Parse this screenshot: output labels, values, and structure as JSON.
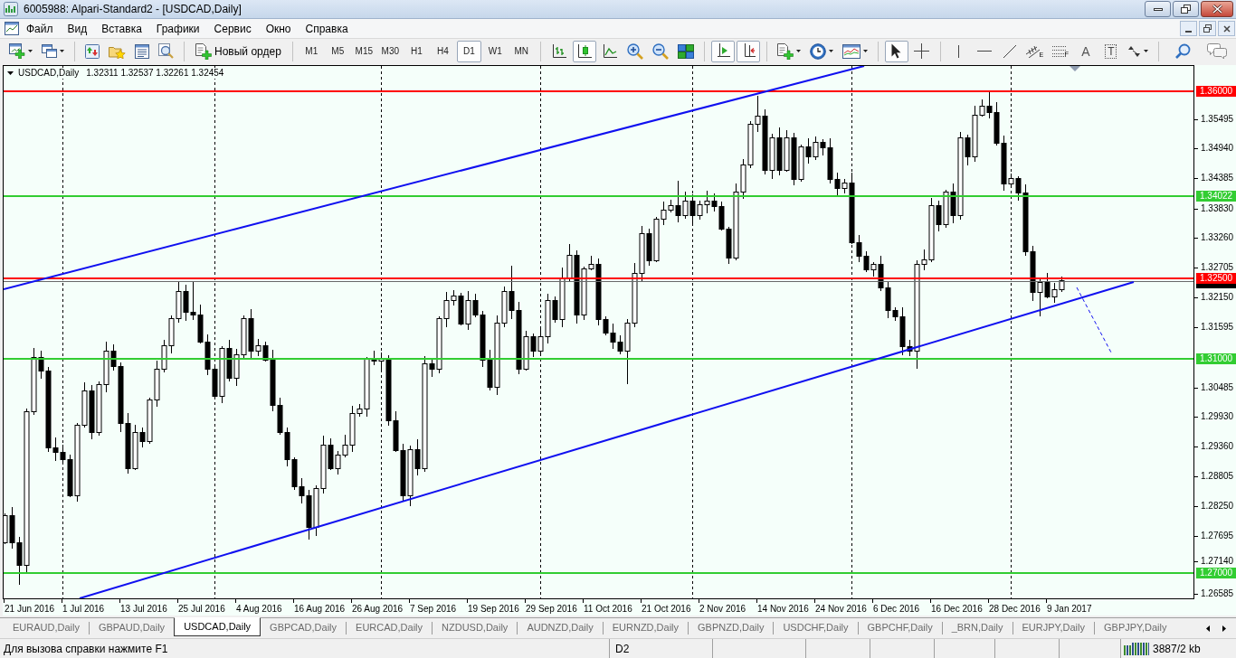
{
  "window": {
    "title": "6005988: Alpari-Standard2 - [USDCAD,Daily]"
  },
  "menu": [
    "Файл",
    "Вид",
    "Вставка",
    "Графики",
    "Сервис",
    "Окно",
    "Справка"
  ],
  "toolbar": {
    "new_order": "Новый ордер",
    "timeframes": [
      {
        "label": "M1",
        "selected": false
      },
      {
        "label": "M5",
        "selected": false
      },
      {
        "label": "M15",
        "selected": false
      },
      {
        "label": "M30",
        "selected": false
      },
      {
        "label": "H1",
        "selected": false
      },
      {
        "label": "H4",
        "selected": false
      },
      {
        "label": "D1",
        "selected": true
      },
      {
        "label": "W1",
        "selected": false
      },
      {
        "label": "MN",
        "selected": false
      }
    ],
    "chart_types": [
      {
        "kind": "bars",
        "selected": false
      },
      {
        "kind": "candles",
        "selected": true
      },
      {
        "kind": "line",
        "selected": false
      }
    ],
    "chart_options": [
      {
        "kind": "autoscroll",
        "on": true
      },
      {
        "kind": "shift",
        "on": true
      }
    ],
    "drawing_tools": [
      {
        "kind": "cursor",
        "selected": true
      },
      {
        "kind": "crosshair",
        "selected": false
      },
      {
        "kind": "vline",
        "selected": false
      },
      {
        "kind": "hline",
        "selected": false
      },
      {
        "kind": "trendline",
        "selected": false
      },
      {
        "kind": "channel",
        "label": "E",
        "selected": false
      },
      {
        "kind": "fibo",
        "label": "F",
        "selected": false
      },
      {
        "kind": "text",
        "label": "A",
        "selected": false
      },
      {
        "kind": "text-label",
        "label": "T",
        "selected": false
      }
    ]
  },
  "chart": {
    "symbol": "USDCAD,Daily",
    "ohlc": "1.32311 1.32537 1.32261 1.32454",
    "levels": [
      {
        "label": "1.36000",
        "color": "#ff0000"
      },
      {
        "label": "1.34022",
        "color": "#32cd32"
      },
      {
        "label": "1.32500",
        "color": "#ff0000"
      },
      {
        "label": "1.31000",
        "color": "#32cd32"
      },
      {
        "label": "1.27000",
        "color": "#32cd32"
      }
    ],
    "price_labels": [
      "1.35495",
      "1.34940",
      "1.34385",
      "1.33830",
      "1.33260",
      "1.32705",
      "1.32150",
      "1.31595",
      "1.30485",
      "1.29930",
      "1.29360",
      "1.28805",
      "1.28250",
      "1.27695",
      "1.27140",
      "1.26585"
    ],
    "date_labels": [
      "21 Jun 2016",
      "1 Jul 2016",
      "13 Jul 2016",
      "25 Jul 2016",
      "4 Aug 2016",
      "16 Aug 2016",
      "26 Aug 2016",
      "7 Sep 2016",
      "19 Sep 2016",
      "29 Sep 2016",
      "11 Oct 2016",
      "21 Oct 2016",
      "2 Nov 2016",
      "14 Nov 2016",
      "24 Nov 2016",
      "6 Dec 2016",
      "16 Dec 2016",
      "28 Dec 2016",
      "9 Jan 2017"
    ]
  },
  "tabs": [
    {
      "label": "EURAUD,Daily",
      "selected": false
    },
    {
      "label": "GBPAUD,Daily",
      "selected": false
    },
    {
      "label": "USDCAD,Daily",
      "selected": true
    },
    {
      "label": "GBPCAD,Daily",
      "selected": false
    },
    {
      "label": "EURCAD,Daily",
      "selected": false
    },
    {
      "label": "NZDUSD,Daily",
      "selected": false
    },
    {
      "label": "AUDNZD,Daily",
      "selected": false
    },
    {
      "label": "EURNZD,Daily",
      "selected": false
    },
    {
      "label": "GBPNZD,Daily",
      "selected": false
    },
    {
      "label": "USDCHF,Daily",
      "selected": false
    },
    {
      "label": "GBPCHF,Daily",
      "selected": false
    },
    {
      "label": "_BRN,Daily",
      "selected": false
    },
    {
      "label": "EURJPY,Daily",
      "selected": false
    },
    {
      "label": "GBPJPY,Daily",
      "selected": false
    }
  ],
  "status_bar": {
    "help": "Для вызова справки нажмите F1",
    "section_2": "D2",
    "connection": "3887/2 kb"
  }
}
